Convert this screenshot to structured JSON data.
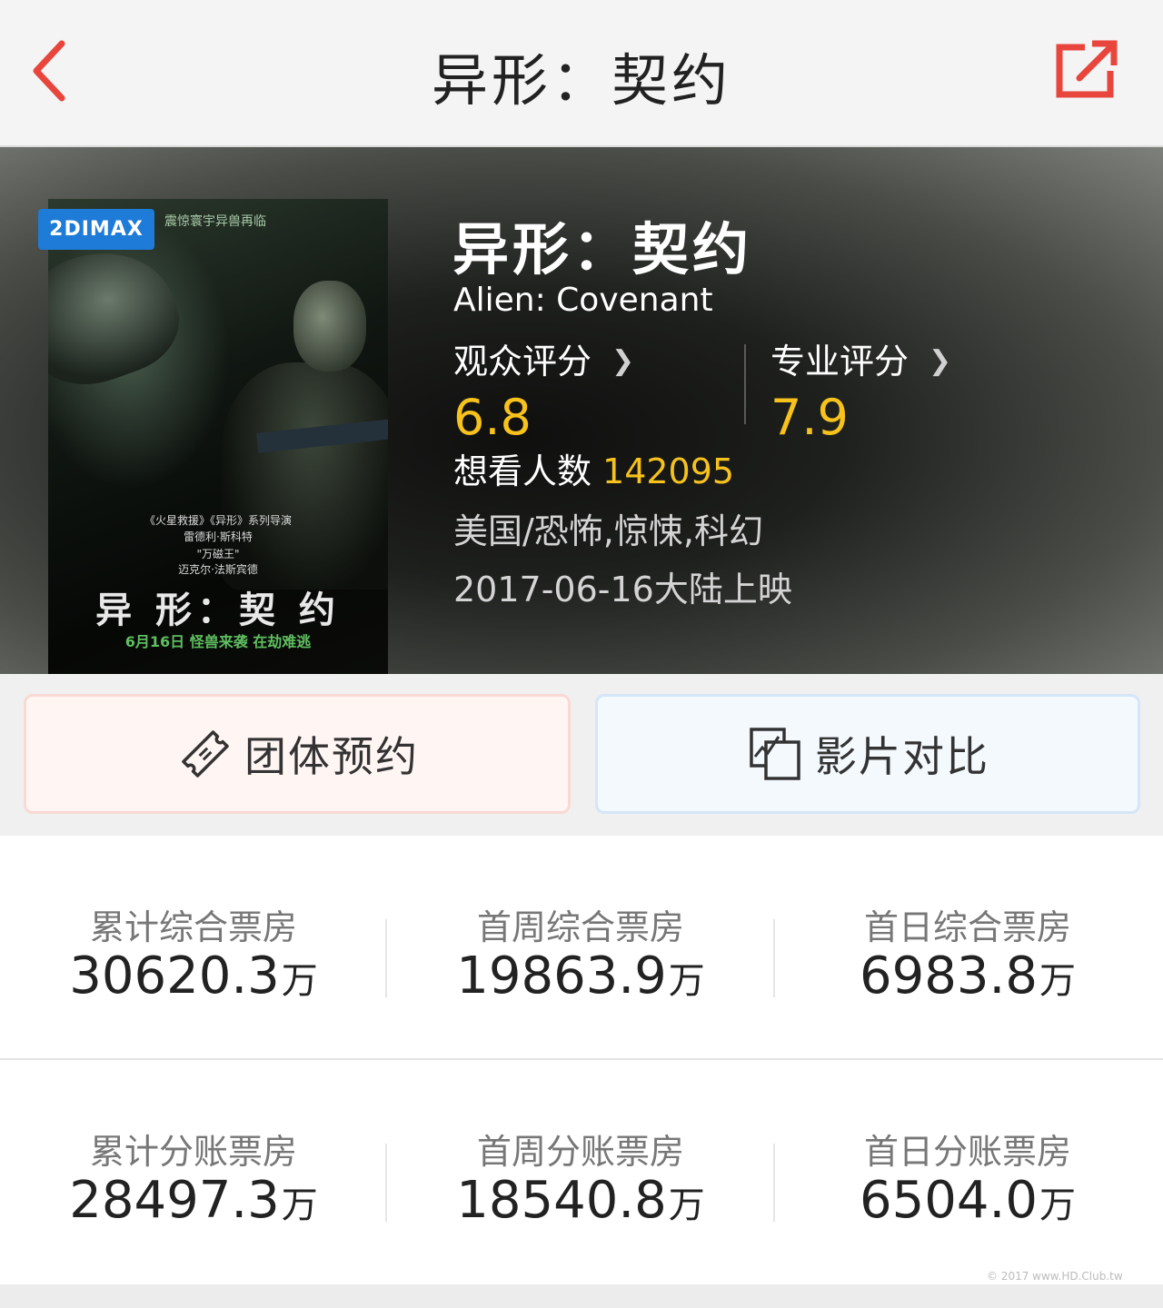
{
  "nav": {
    "title": "异形：契约"
  },
  "poster": {
    "badge": "2DIMAX",
    "tagline": "震惊寰宇异兽再临",
    "credits": [
      "《火星救援》《异形》系列导演",
      "雷德利·斯科特",
      "\"万磁王\"",
      "迈克尔·法斯宾德"
    ],
    "title": "异 形：契 约",
    "date_line": "6月16日 怪兽来袭 在劫难逃"
  },
  "movie": {
    "title_cn": "异形：契约",
    "title_en": "Alien: Covenant",
    "audience_score_label": "观众评分",
    "audience_score": "6.8",
    "pro_score_label": "专业评分",
    "pro_score": "7.9",
    "want_label": "想看人数",
    "want_count": "142095",
    "genre": "美国/恐怖,惊悚,科幻",
    "release": "2017-06-16大陆上映"
  },
  "actions": {
    "group_label": "团体预约",
    "compare_label": "影片对比"
  },
  "box_office": {
    "unit": "万",
    "row1": [
      {
        "label": "累计综合票房",
        "value": "30620.3"
      },
      {
        "label": "首周综合票房",
        "value": "19863.9"
      },
      {
        "label": "首日综合票房",
        "value": "6983.8"
      }
    ],
    "row2": [
      {
        "label": "累计分账票房",
        "value": "28497.3"
      },
      {
        "label": "首周分账票房",
        "value": "18540.8"
      },
      {
        "label": "首日分账票房",
        "value": "6504.0"
      }
    ]
  },
  "watermark": "© 2017 www.HD.Club.tw",
  "colors": {
    "accent_red": "#e8453c",
    "score_yellow": "#f7c21c",
    "badge_blue": "#1e7bd8"
  }
}
